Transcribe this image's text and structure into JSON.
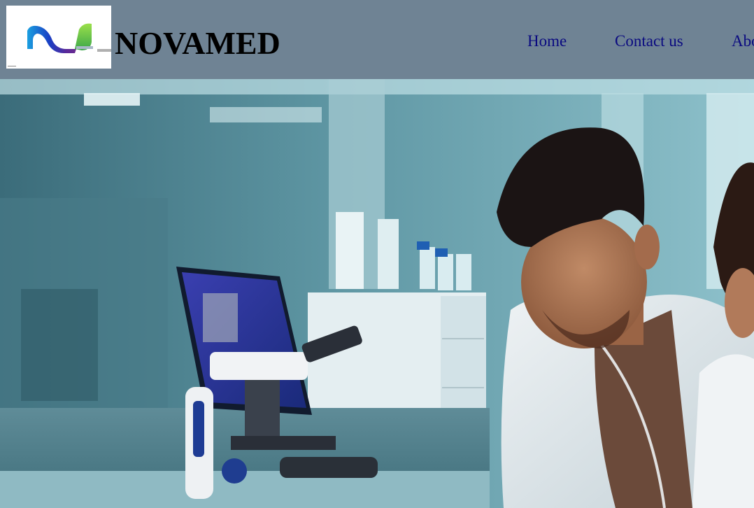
{
  "header": {
    "brand_name": "NOVAMED",
    "logo_icon": "novamed-wave-logo",
    "nav": {
      "home": "Home",
      "contact": "Contact us",
      "about": "Abo"
    }
  },
  "hero": {
    "image": "lab-scientists-microscope-photo"
  },
  "colors": {
    "header_bg": "#6f8394",
    "nav_link": "#0a0a80",
    "brand_text": "#000000"
  }
}
